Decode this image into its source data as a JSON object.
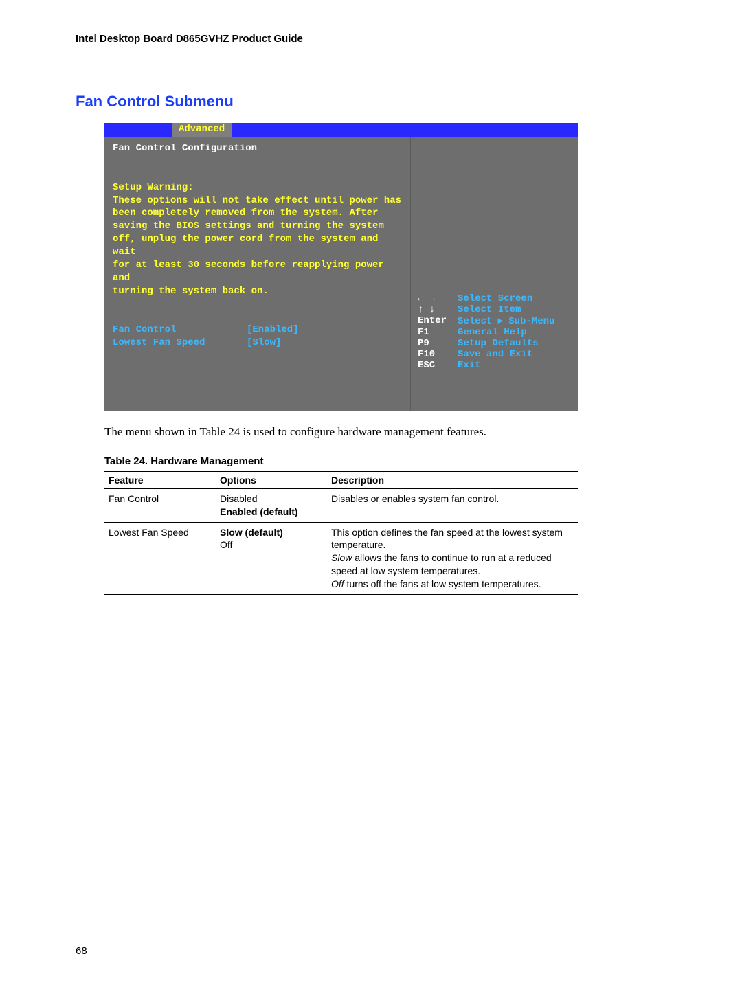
{
  "doc_header": "Intel Desktop Board D865GVHZ Product Guide",
  "section_title": "Fan Control Submenu",
  "bios": {
    "tab": "Advanced",
    "subtitle": "Fan Control Configuration",
    "warning_label": "Setup Warning:",
    "warning_lines": [
      "These options will not take effect until power has",
      "been completely removed from the system.  After",
      "saving the BIOS settings and turning the system",
      "off, unplug the power cord from the system and wait",
      "for at least 30 seconds before reapplying power and",
      "turning the system back on."
    ],
    "settings": [
      {
        "label": "Fan Control",
        "value": "[Enabled]"
      },
      {
        "label": "Lowest Fan Speed",
        "value": "[Slow]"
      }
    ],
    "nav": [
      {
        "key_glyph": "← →",
        "text": "Select Screen"
      },
      {
        "key_glyph": "↑ ↓",
        "text": "Select Item"
      },
      {
        "key_glyph": "Enter",
        "text": "Select ▸ Sub-Menu"
      },
      {
        "key_glyph": "F1",
        "text": "General Help"
      },
      {
        "key_glyph": "P9",
        "text": "Setup Defaults"
      },
      {
        "key_glyph": "F10",
        "text": "Save and Exit"
      },
      {
        "key_glyph": "ESC",
        "text": "Exit"
      }
    ]
  },
  "caption": "The menu shown in Table 24 is used to configure hardware management features.",
  "table_title": "Table 24.   Hardware Management",
  "table": {
    "headers": {
      "feature": "Feature",
      "options": "Options",
      "description": "Description"
    },
    "rows": [
      {
        "feature": "Fan Control",
        "options_plain": "Disabled",
        "options_bold": "Enabled (default)",
        "description_plain": "Disables or enables system fan control."
      },
      {
        "feature": "Lowest Fan Speed",
        "options_bold": "Slow (default)",
        "options_plain": "Off",
        "desc_line1": "This option defines the fan speed at the lowest system temperature.",
        "desc_italic1_a": "Slow",
        "desc_line2": " allows the fans to continue to run at a reduced speed at low system temperatures.",
        "desc_italic2_a": "Off",
        "desc_line3": " turns off the fans at low system temperatures."
      }
    ]
  },
  "page_number": "68"
}
